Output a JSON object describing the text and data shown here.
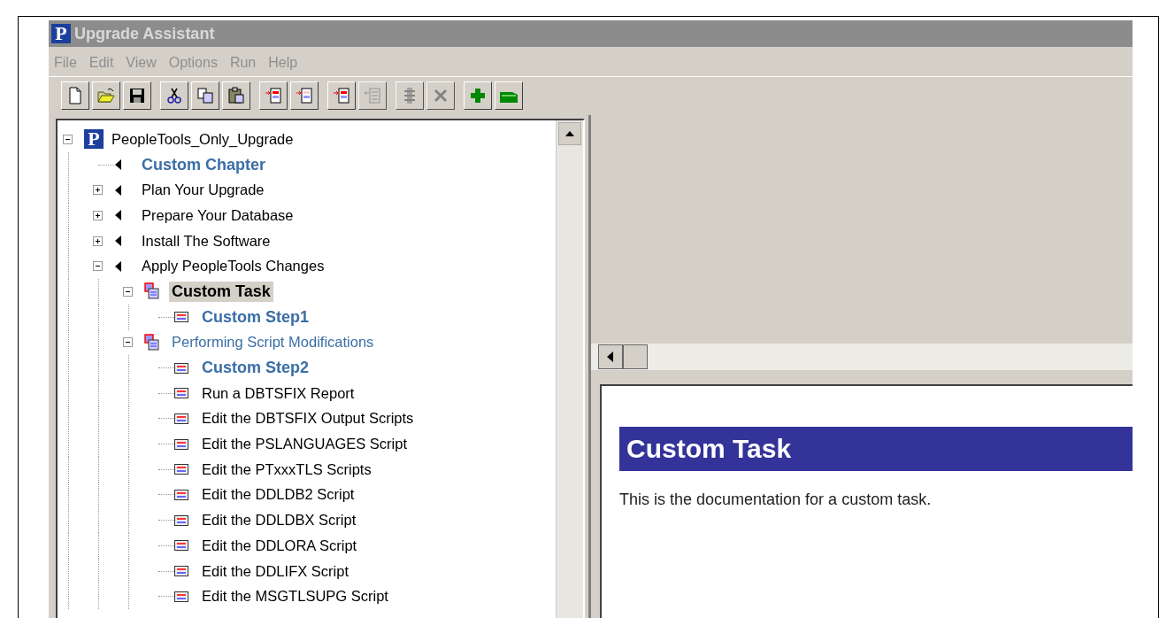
{
  "window": {
    "logo": "P",
    "title": "Upgrade Assistant",
    "active": false
  },
  "menu": [
    {
      "label": "File",
      "disabled": true
    },
    {
      "label": "Edit",
      "disabled": true
    },
    {
      "label": "View",
      "disabled": true
    },
    {
      "label": "Options",
      "disabled": true
    },
    {
      "label": "Run",
      "disabled": true
    },
    {
      "label": "Help",
      "disabled": true
    }
  ],
  "toolbar": [
    [
      {
        "kind": "new",
        "disabled": false
      },
      {
        "kind": "open",
        "disabled": false
      },
      {
        "kind": "save",
        "disabled": false
      }
    ],
    [
      {
        "kind": "cut",
        "disabled": false
      },
      {
        "kind": "copy",
        "disabled": false
      },
      {
        "kind": "paste",
        "disabled": false
      }
    ],
    [
      {
        "kind": "insert-before",
        "disabled": false
      },
      {
        "kind": "insert-after",
        "disabled": false
      }
    ],
    [
      {
        "kind": "insert-child",
        "disabled": false
      },
      {
        "kind": "outdent",
        "disabled": true
      }
    ],
    [
      {
        "kind": "run",
        "disabled": true
      },
      {
        "kind": "delete",
        "disabled": true
      }
    ],
    [
      {
        "kind": "add",
        "disabled": false
      },
      {
        "kind": "remove",
        "disabled": false
      }
    ]
  ],
  "tree": [
    {
      "label": "PeopleTools_Only_Upgrade",
      "kind": "root",
      "badge": "P",
      "expanded": true,
      "custom": false,
      "selected": false,
      "children": [
        {
          "label": "Custom Chapter",
          "kind": "chapter",
          "custom": true,
          "selected": false
        },
        {
          "label": "Plan Your Upgrade",
          "kind": "chapter",
          "expanded": false,
          "custom": false,
          "selected": false
        },
        {
          "label": "Prepare Your Database",
          "kind": "chapter",
          "expanded": false,
          "custom": false,
          "selected": false
        },
        {
          "label": "Install The Software",
          "kind": "chapter",
          "expanded": false,
          "custom": false,
          "selected": false
        },
        {
          "label": "Apply PeopleTools Changes",
          "kind": "chapter",
          "expanded": true,
          "custom": false,
          "selected": false,
          "children": [
            {
              "label": "Custom Task",
              "kind": "task",
              "expanded": true,
              "custom": true,
              "selected": true,
              "children": [
                {
                  "label": "Custom Step1",
                  "kind": "step",
                  "custom": true,
                  "selected": false
                }
              ]
            },
            {
              "label": "Performing Script Modifications",
              "kind": "task",
              "expanded": true,
              "custom": false,
              "modified": true,
              "selected": false,
              "children": [
                {
                  "label": "Custom Step2",
                  "kind": "step",
                  "custom": true,
                  "selected": false
                },
                {
                  "label": "Run a DBTSFIX Report",
                  "kind": "step",
                  "custom": false,
                  "selected": false
                },
                {
                  "label": "Edit the DBTSFIX Output Scripts",
                  "kind": "step",
                  "custom": false,
                  "selected": false
                },
                {
                  "label": "Edit the PSLANGUAGES Script",
                  "kind": "step",
                  "custom": false,
                  "selected": false
                },
                {
                  "label": "Edit the PTxxxTLS Scripts",
                  "kind": "step",
                  "custom": false,
                  "selected": false
                },
                {
                  "label": "Edit the DDLDB2 Script",
                  "kind": "step",
                  "custom": false,
                  "selected": false
                },
                {
                  "label": "Edit the DDLDBX Script",
                  "kind": "step",
                  "custom": false,
                  "selected": false
                },
                {
                  "label": "Edit the DDLORA Script",
                  "kind": "step",
                  "custom": false,
                  "selected": false
                },
                {
                  "label": "Edit the DDLIFX Script",
                  "kind": "step",
                  "custom": false,
                  "selected": false
                },
                {
                  "label": "Edit the MSGTLSUPG Script",
                  "kind": "step",
                  "custom": false,
                  "selected": false
                }
              ]
            }
          ]
        }
      ]
    }
  ],
  "document": {
    "heading": "Custom Task",
    "body": "This is the documentation for a custom task."
  }
}
